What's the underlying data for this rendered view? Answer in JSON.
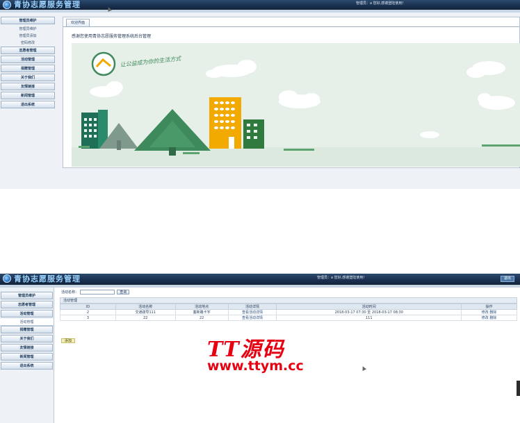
{
  "app": {
    "title": "青协志愿服务管理"
  },
  "screen1": {
    "user_info": "管理员：a 您好,感谢登陆使用！",
    "menu": [
      {
        "label": "管理员维护",
        "subitems": [
          "管理员维护",
          "管理员添加",
          "密码修改"
        ]
      },
      {
        "label": "志愿者管理"
      },
      {
        "label": "活动管理"
      },
      {
        "label": "捐赠管理"
      },
      {
        "label": "关于我们"
      },
      {
        "label": "友情链接"
      },
      {
        "label": "新闻管理"
      },
      {
        "label": "退出系统"
      }
    ],
    "tab_label": "欢迎界面",
    "welcome_text": "感谢您使用青协志愿服务管理系统后台管理",
    "banner_slogan": "让公益成为你的生活方式"
  },
  "screen2": {
    "user_info": "管理员：a 您好,感谢登陆使用！",
    "logout_label": "退出",
    "menu": [
      {
        "label": "管理员维护"
      },
      {
        "label": "志愿者管理"
      },
      {
        "label": "活动管理",
        "subitems": [
          "活动管理"
        ]
      },
      {
        "label": "捐赠管理"
      },
      {
        "label": "关于我们"
      },
      {
        "label": "友情链接"
      },
      {
        "label": "新闻管理"
      },
      {
        "label": "退出系统"
      }
    ],
    "search_label": "活动名称：",
    "search_value": "",
    "query_label": "查询",
    "section_title": "活动管理",
    "columns": [
      "ID",
      "活动名称",
      "活动地点",
      "活动详情",
      "活动时间",
      "操作"
    ],
    "rows": [
      [
        "2",
        "交通疏导111",
        "塞新路卡字",
        "查看活动详情",
        "2018-03-17 07:30 至 2018-03-17 08:30",
        "修改 删除"
      ],
      [
        "3",
        "22",
        "22",
        "查看活动详情",
        "111",
        "修改 删除"
      ]
    ],
    "add_label": "添加"
  },
  "watermark": {
    "text": "TT源码",
    "url": "www.ttym.cc",
    "color": "#e60012"
  },
  "colors": {
    "header": "#1b3150",
    "title": "#9fd3ff",
    "accent_yellow": "#f2a900",
    "accent_green": "#2f7a56"
  }
}
